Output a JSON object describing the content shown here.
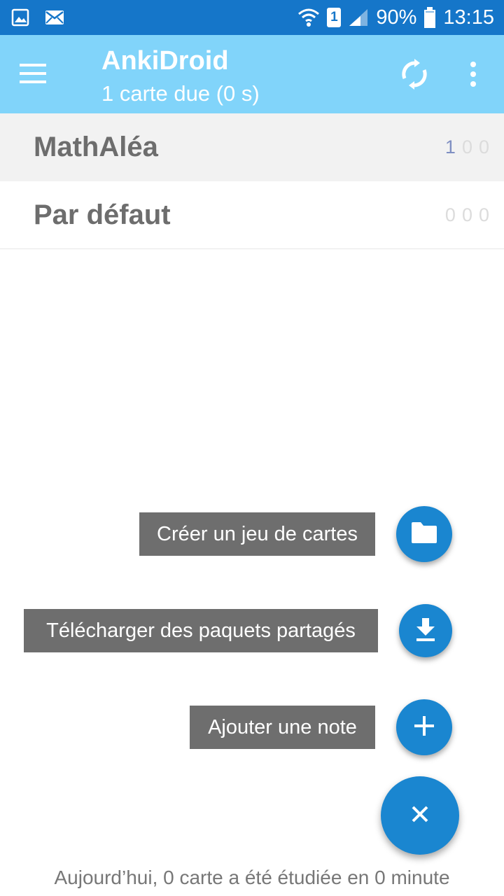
{
  "status_bar": {
    "sim_slot": "1",
    "battery": "90%",
    "time": "13:15",
    "icons": [
      "image-icon",
      "mail-icon",
      "wifi-icon",
      "sim-icon",
      "signal-icon",
      "battery-icon"
    ]
  },
  "toolbar": {
    "title": "AnkiDroid",
    "subtitle": "1 carte due (0 s)",
    "background": "#81d4fa",
    "icons": [
      "menu-icon",
      "sync-icon",
      "more-vert-icon"
    ]
  },
  "decks": [
    {
      "name": "MathAléa",
      "counts": [
        "1",
        "0",
        "0"
      ]
    },
    {
      "name": "Par défaut",
      "counts": [
        "0",
        "0",
        "0"
      ]
    }
  ],
  "fab_menu": {
    "create_deck": "Créer un jeu de cartes",
    "download_shared": "Télécharger des paquets partagés",
    "add_note": "Ajouter une note",
    "accent": "#1a86d0",
    "icons": [
      "folder-icon",
      "download-icon",
      "plus-icon",
      "close-icon"
    ]
  },
  "footer": {
    "text": "Aujourd’hui, 0 carte a été étudiée en 0 minute"
  }
}
